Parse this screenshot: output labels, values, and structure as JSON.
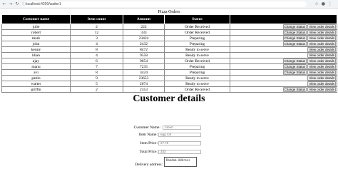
{
  "browser": {
    "url": "localhost:4200/waiter1"
  },
  "orders": {
    "caption": "Pizza Orders",
    "columns": [
      "Customer name",
      "Item count",
      "Amount",
      "Status",
      ""
    ],
    "rows": [
      {
        "name": "julie",
        "count": "2",
        "amount": "222",
        "status": "Order Received",
        "buttons": [
          "Change Status",
          "View order details"
        ]
      },
      {
        "name": "robert",
        "count": "12",
        "amount": "333",
        "status": "Order Received",
        "buttons": [
          "Change Status",
          "View order details"
        ]
      },
      {
        "name": "mark",
        "count": "3",
        "amount": "23424",
        "status": "Preparing",
        "buttons": [
          "Change Status",
          "View order details"
        ]
      },
      {
        "name": "john",
        "count": "4",
        "amount": "2432",
        "status": "Preparing",
        "buttons": [
          "Change Status",
          "View order details"
        ]
      },
      {
        "name": "kenny",
        "count": "8",
        "amount": "8472",
        "status": "Ready to serve",
        "buttons": [
          "View order details"
        ]
      },
      {
        "name": "khan",
        "count": "4",
        "amount": "9558",
        "status": "Ready to serve",
        "buttons": [
          "View order details"
        ]
      },
      {
        "name": "ajay",
        "count": "6",
        "amount": "9654",
        "status": "Order Received",
        "buttons": [
          "Change Status",
          "View order details"
        ]
      },
      {
        "name": "manu",
        "count": "7",
        "amount": "7235",
        "status": "Preparing",
        "buttons": [
          "Change Status",
          "View order details"
        ]
      },
      {
        "name": "avi",
        "count": "8",
        "amount": "3424",
        "status": "Preparing",
        "buttons": [
          "Change Status",
          "View order details"
        ]
      },
      {
        "name": "pablo",
        "count": "9",
        "amount": "23653",
        "status": "Ready to serve",
        "buttons": [
          "View order details"
        ]
      },
      {
        "name": "walter",
        "count": "5",
        "amount": "2674",
        "status": "Ready to serve",
        "buttons": [
          "View order details"
        ]
      },
      {
        "name": "griffin",
        "count": "2",
        "amount": "2353",
        "status": "Order Received",
        "buttons": [
          "Change Status",
          "View order details"
        ]
      }
    ]
  },
  "details": {
    "title": "Customer details",
    "customer_name_label": "Customer Name:",
    "customer_name_value": "robert",
    "item_name_label": "Item Name:",
    "item_name_value": "egg roll",
    "item_price_label": "Item Price:",
    "item_price_value": "27.75",
    "total_price_label": "Total Price:",
    "total_price_value": "333",
    "address_label": "Delivery address:",
    "address_value": "Random Address"
  }
}
